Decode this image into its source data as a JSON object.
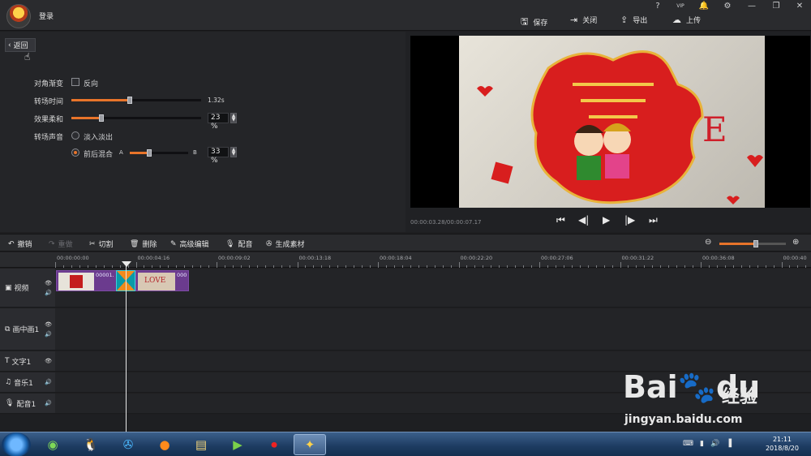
{
  "header": {
    "login": "登录",
    "help": "?",
    "vip": "VIP",
    "min": "—",
    "max": "❐",
    "close": "✕",
    "actions": [
      {
        "label": "保存",
        "icon": "🖫"
      },
      {
        "label": "关闭",
        "icon": "⇥"
      },
      {
        "label": "导出",
        "icon": "⇪"
      },
      {
        "label": "上传",
        "icon": "☁"
      }
    ]
  },
  "panel": {
    "back": "返回",
    "diagonal": {
      "label": "对角渐变",
      "option": "反向"
    },
    "duration": {
      "label": "转场时间",
      "value": "1.32s",
      "fraction": 0.45
    },
    "softness": {
      "label": "效果柔和",
      "value": "23",
      "unit": "%",
      "fraction": 0.23
    },
    "sound": {
      "label": "转场声音",
      "opt1": "淡入淡出",
      "opt2": "前后混合",
      "a": "A",
      "b": "B",
      "value": "33",
      "unit": "%",
      "fraction": 0.33
    }
  },
  "preview": {
    "time": "00:00:03.28/00:00:07.17"
  },
  "toolbar": {
    "undo": "撤销",
    "redo": "重做",
    "cut": "切割",
    "delete": "删除",
    "advanced": "高级编辑",
    "dub": "配音",
    "generate": "生成素材",
    "zoom_fraction": 0.55
  },
  "ruler": {
    "labels": [
      "00:00:00:00",
      "00:00:04:16",
      "00:00:09:02",
      "00:00:13:18",
      "00:00:18:04",
      "00:00:22:20",
      "00:00:27:06",
      "00:00:31:22",
      "00:00:36:08",
      "00:00:40"
    ]
  },
  "tracks": {
    "video": "视频",
    "pip": "画中画1",
    "text": "文字1",
    "music": "音乐1",
    "voice": "配音1"
  },
  "clips": {
    "c1": "00001.",
    "c2": "000",
    "love": "LOVE"
  },
  "taskbar": {
    "time": "21:11",
    "date": "2018/8/20"
  },
  "watermark": {
    "brand": "Bai",
    "brand2": "du",
    "jy": "经验",
    "url": "jingyan.baidu.com"
  }
}
